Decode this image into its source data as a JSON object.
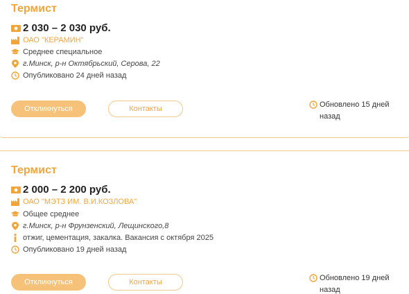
{
  "colors": {
    "accent": "#f0a53c",
    "button_fill": "#f6c27a",
    "divider": "#f1c98a"
  },
  "vacancies": [
    {
      "title": "Термист",
      "salary": "2 030 – 2 030 руб.",
      "company": "ОАО \"КЕРАМИН\"",
      "education": "Среднее специальное",
      "address": "г.Минск, р-н Октябрьский, Серова, 22",
      "published": "Опубликовано 24 дней назад",
      "respond_label": "Откликнуться",
      "contacts_label": "Контакты",
      "updated": "Обновлено 15 дней назад"
    },
    {
      "title": "Термист",
      "salary": "2 000 – 2 200 руб.",
      "company": "ОАО \"МЭТЗ ИМ. В.И.КОЗЛОВА\"",
      "education": "Общее среднее",
      "address": "г.Минск, р-н Фрунзенский, Лещинского,8",
      "info": "отжиг, цементация, закалка. Вакансия с октября 2025",
      "published": "Опубликовано 19 дней назад",
      "respond_label": "Откликнуться",
      "contacts_label": "Контакты",
      "updated": "Обновлено 19 дней назад"
    }
  ]
}
